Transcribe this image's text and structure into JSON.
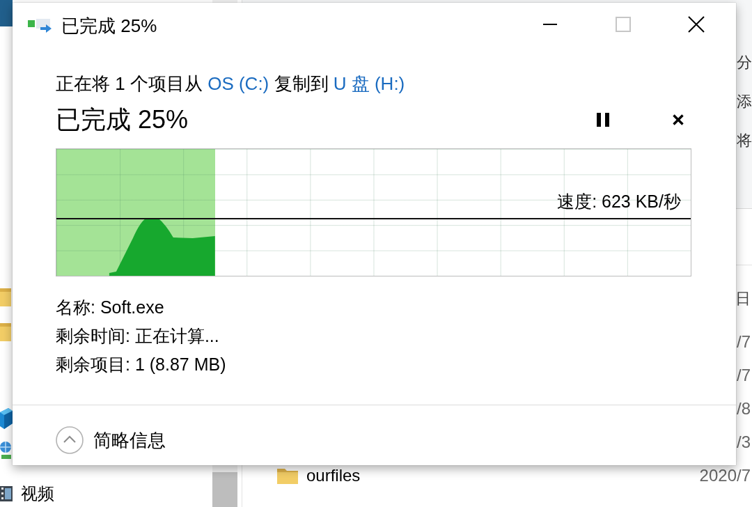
{
  "explorer": {
    "ribbon_labels": [
      "分",
      "添",
      "将"
    ],
    "nav_items": [
      {
        "kind": "folder"
      },
      {
        "kind": "folder"
      },
      {
        "kind": "cube"
      },
      {
        "kind": "network"
      },
      {
        "kind": "video",
        "label": "视频"
      }
    ],
    "column_header": "日",
    "rows": [
      {
        "date": "/7"
      },
      {
        "date": "/7"
      },
      {
        "date": "/8"
      },
      {
        "date": "/3"
      },
      {
        "name": "ourfiles",
        "date": "2020/7"
      }
    ]
  },
  "dialog": {
    "title": "已完成 25%",
    "controls": [
      {
        "kind": "minimize",
        "disabled": false
      },
      {
        "kind": "maximize",
        "disabled": true
      },
      {
        "kind": "close",
        "disabled": false
      }
    ],
    "description": [
      {
        "kind": "text",
        "text": "正在将 1 个项目从"
      },
      {
        "kind": "link",
        "text": "OS (C:)"
      },
      {
        "kind": "text",
        "text": "复制到"
      },
      {
        "kind": "link",
        "text": "U 盘 (H:)"
      }
    ],
    "status": "已完成 25%",
    "actions": [
      {
        "kind": "pause"
      },
      {
        "kind": "cancel"
      }
    ],
    "graph": {
      "level": 0.25,
      "speed": "速度: 623 KB/秒"
    },
    "details": [
      "名称: Soft.exe",
      "剩余时间: 正在计算...",
      "剩余项目: 1 (8.87 MB)"
    ],
    "details_toggle": {
      "label": "简略信息",
      "expanded": true
    }
  }
}
